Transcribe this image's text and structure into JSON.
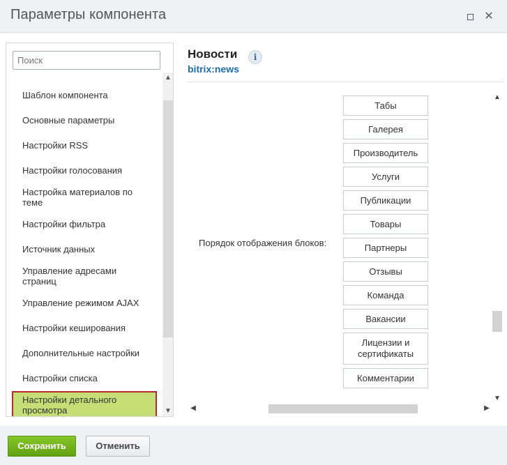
{
  "window": {
    "title": "Параметры компонента",
    "maximize_icon": "maximize-icon",
    "close_icon": "close-icon"
  },
  "sidebar": {
    "search_placeholder": "Поиск",
    "items": [
      {
        "label": "Шаблон компонента"
      },
      {
        "label": "Основные параметры"
      },
      {
        "label": "Настройки RSS"
      },
      {
        "label": "Настройки голосования"
      },
      {
        "label": "Настройка материалов по теме"
      },
      {
        "label": "Настройки фильтра"
      },
      {
        "label": "Источник данных"
      },
      {
        "label": "Управление адресами страниц"
      },
      {
        "label": "Управление режимом AJAX"
      },
      {
        "label": "Настройки кеширования"
      },
      {
        "label": "Дополнительные настройки"
      },
      {
        "label": "Настройки списка"
      },
      {
        "label": "Настройки детального просмотра",
        "active": true
      }
    ],
    "active_highlight_color": "#c5de75",
    "active_border_color": "#b9292b"
  },
  "component": {
    "name": "Новости",
    "code": "bitrix:news",
    "info_icon": "info-icon"
  },
  "param": {
    "label": "Порядок отображения блоков:",
    "blocks": [
      "Табы",
      "Галерея",
      "Производитель",
      "Услуги",
      "Публикации",
      "Товары",
      "Партнеры",
      "Отзывы",
      "Команда",
      "Вакансии",
      "Лицензии и сертификаты",
      "Комментарии"
    ]
  },
  "footer": {
    "save_label": "Сохранить",
    "cancel_label": "Отменить"
  },
  "colors": {
    "save_button": "#6fb31c",
    "link": "#1c6fa8"
  }
}
